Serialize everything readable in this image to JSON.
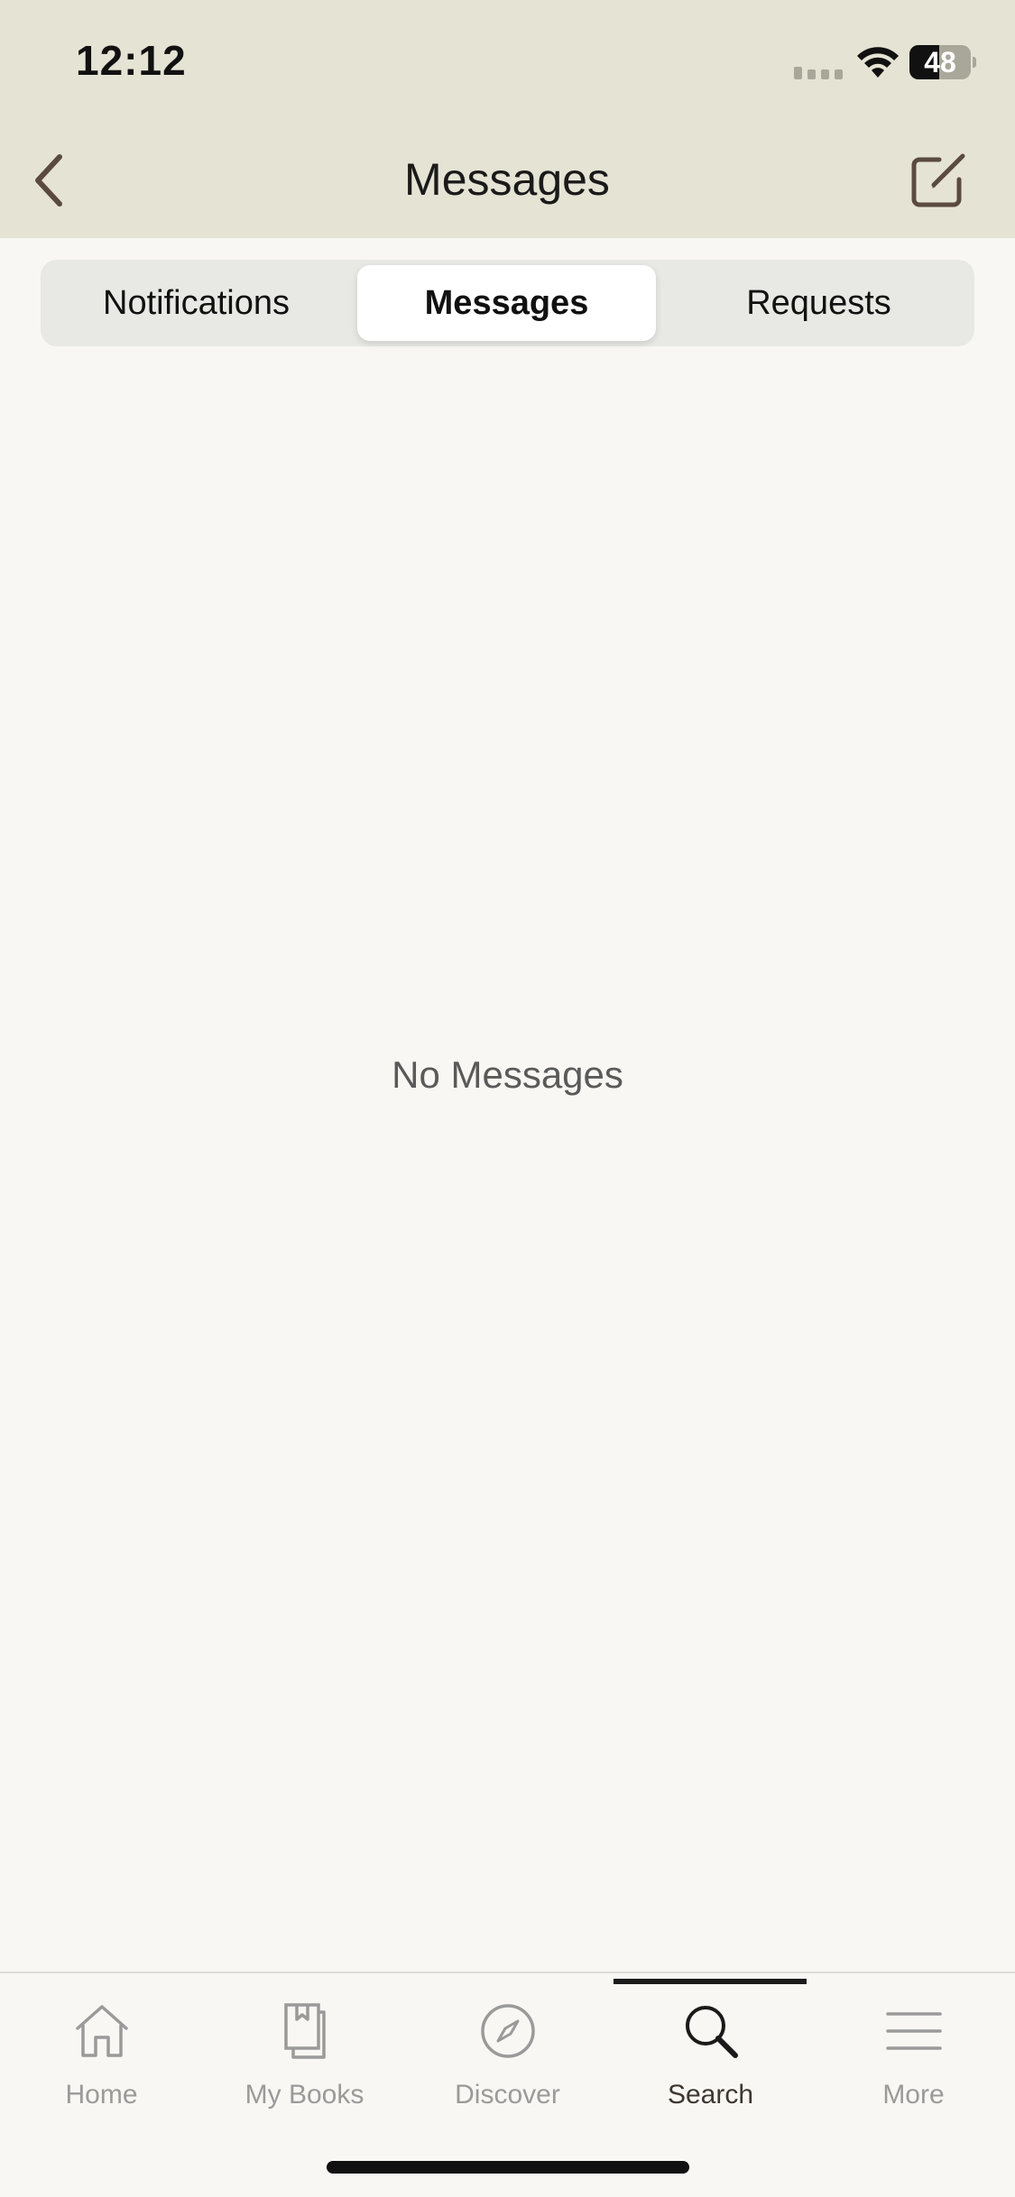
{
  "status_bar": {
    "time": "12:12",
    "battery": "48",
    "battery_level": 0.48
  },
  "nav": {
    "title": "Messages",
    "back_icon": "chevron-left-icon",
    "compose_icon": "compose-icon"
  },
  "segments": [
    {
      "label": "Notifications",
      "selected": false
    },
    {
      "label": "Messages",
      "selected": true
    },
    {
      "label": "Requests",
      "selected": false
    }
  ],
  "empty_state": {
    "text": "No Messages"
  },
  "tab_bar": {
    "items": [
      {
        "label": "Home",
        "icon": "home-icon",
        "active": false
      },
      {
        "label": "My Books",
        "icon": "books-icon",
        "active": false
      },
      {
        "label": "Discover",
        "icon": "compass-icon",
        "active": false
      },
      {
        "label": "Search",
        "icon": "search-icon",
        "active": true
      },
      {
        "label": "More",
        "icon": "menu-icon",
        "active": false
      }
    ]
  },
  "colors": {
    "header_bg": "#e5e3d4",
    "page_bg": "#f8f7f3",
    "accent_dark": "#3d3730",
    "inactive": "#9a9a9a"
  }
}
